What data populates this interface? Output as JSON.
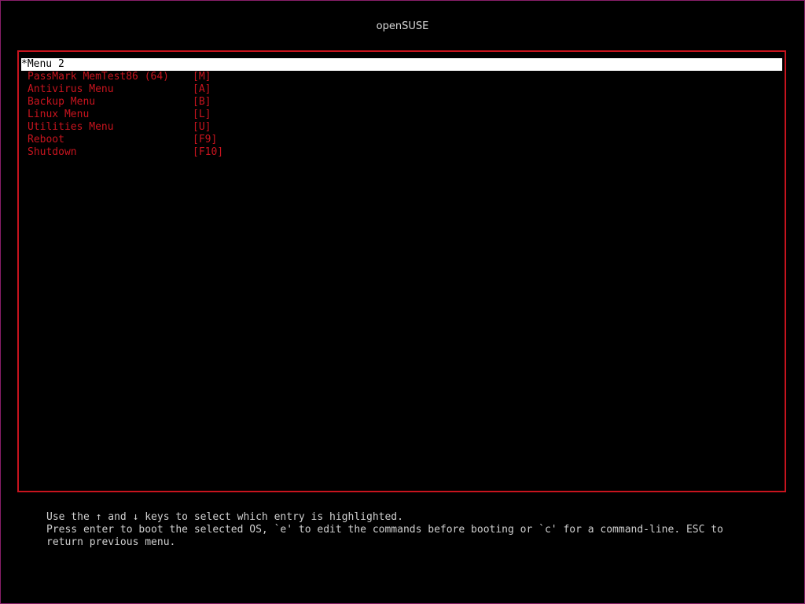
{
  "header": {
    "title": "openSUSE"
  },
  "menu": {
    "entries": [
      {
        "label": "*Menu 2",
        "key": "",
        "selected": true
      },
      {
        "label": "PassMark MemTest86 (64)",
        "key": "[M]",
        "selected": false
      },
      {
        "label": "Antivirus Menu",
        "key": "[A]",
        "selected": false
      },
      {
        "label": "Backup Menu",
        "key": "[B]",
        "selected": false
      },
      {
        "label": "Linux Menu",
        "key": "[L]",
        "selected": false
      },
      {
        "label": "Utilities Menu",
        "key": "[U]",
        "selected": false
      },
      {
        "label": "Reboot",
        "key": "[F9]",
        "selected": false
      },
      {
        "label": "Shutdown",
        "key": "[F10]",
        "selected": false
      }
    ]
  },
  "help": {
    "line1": "Use the ↑ and ↓ keys to select which entry is highlighted.",
    "line2": "Press enter to boot the selected OS, `e' to edit the commands before booting or `c' for a command-line. ESC to",
    "line3": "return previous menu."
  },
  "colors": {
    "background": "#000000",
    "accent_red": "#c8141e",
    "highlight_bg": "#ffffff",
    "highlight_fg": "#000000",
    "frame_magenta": "#8a1f6a",
    "help_text": "#d0d0d0"
  }
}
